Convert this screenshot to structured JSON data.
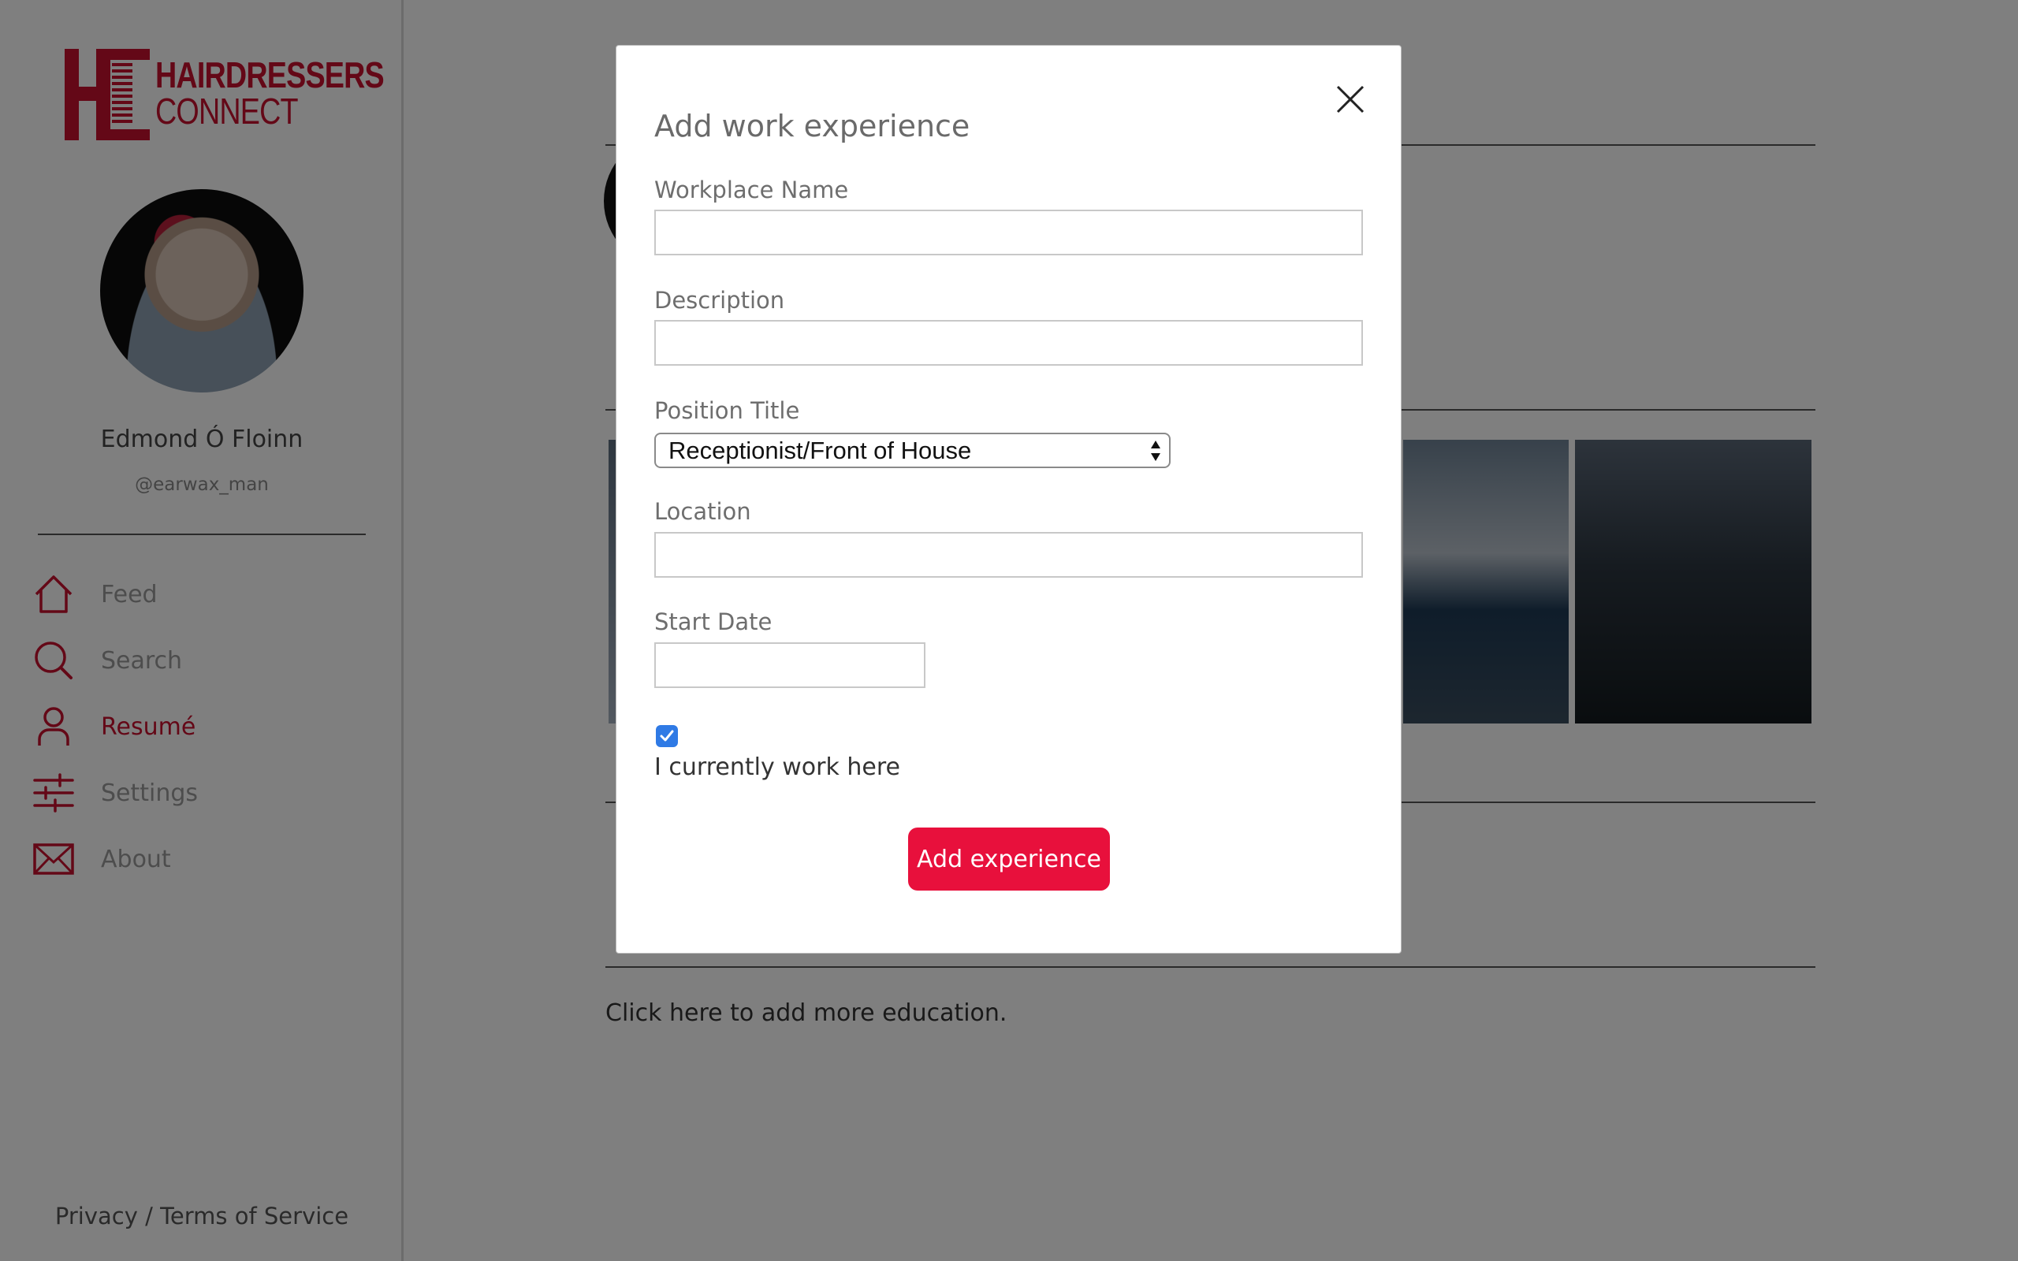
{
  "brand": {
    "line1": "HAIRDRESSERS",
    "line2": "CONNECT",
    "accent_color": "#c8102e"
  },
  "profile": {
    "name": "Edmond Ó Floinn",
    "handle": "@earwax_man"
  },
  "nav": {
    "items": [
      {
        "label": "Feed",
        "icon": "home-icon",
        "active": false
      },
      {
        "label": "Search",
        "icon": "search-icon",
        "active": false
      },
      {
        "label": "Resumé",
        "icon": "user-icon",
        "active": true
      },
      {
        "label": "Settings",
        "icon": "sliders-icon",
        "active": false
      },
      {
        "label": "About",
        "icon": "mail-icon",
        "active": false
      }
    ]
  },
  "footer": {
    "links": "Privacy / Terms of Service"
  },
  "background": {
    "add_education_text": "Click here to add more education."
  },
  "modal": {
    "title": "Add work experience",
    "close_icon": "close-icon",
    "fields": {
      "workplace_name": {
        "label": "Workplace Name",
        "value": ""
      },
      "description": {
        "label": "Description",
        "value": ""
      },
      "position_title": {
        "label": "Position Title",
        "selected": "Receptionist/Front of House"
      },
      "location": {
        "label": "Location",
        "value": ""
      },
      "start_date": {
        "label": "Start Date",
        "value": ""
      }
    },
    "current_work": {
      "label": "I currently work here",
      "checked": true
    },
    "submit_label": "Add experience",
    "submit_color": "#e8103c"
  }
}
